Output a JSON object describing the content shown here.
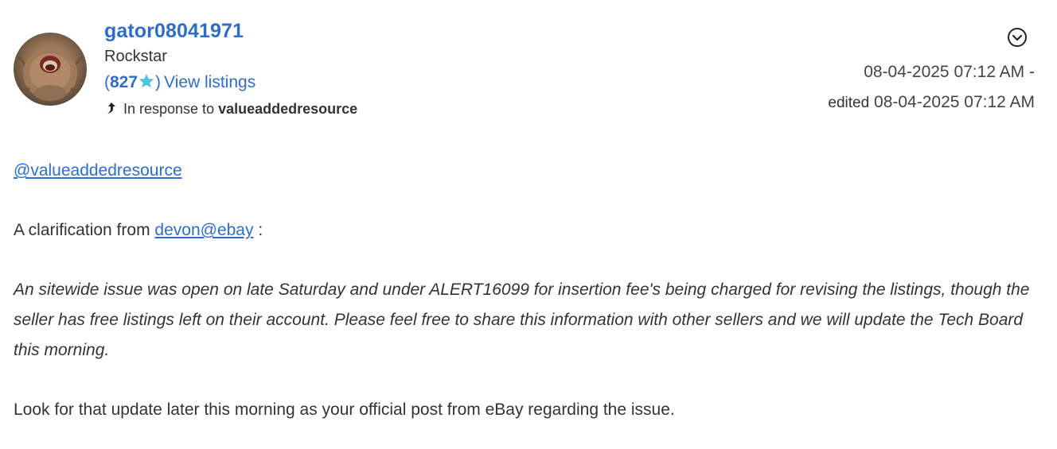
{
  "author": {
    "username": "gator08041971",
    "rank": "Rockstar",
    "feedback_open": "(",
    "feedback_score": "827",
    "feedback_close": ")",
    "view_listings": "View listings",
    "in_response_label": "In response to",
    "in_response_to": "valueaddedresource",
    "avatar_icon": "avatar-image"
  },
  "timestamps": {
    "posted": "08-04-2025 07:12 AM -",
    "edited_label": "edited",
    "edited": "08-04-2025 07:12 AM"
  },
  "post": {
    "mention": "@valueaddedresource",
    "clarify_prefix": "A clarification from",
    "clarify_link": "devon@ebay",
    "clarify_suffix": " :",
    "quote": "An sitewide issue was open on late Saturday and under ALERT16099 for insertion fee's being charged for revising the listings, though the seller has free listings left on their account. Please feel free to share this information with other sellers and we will update the Tech Board this morning.",
    "closing": "Look for that update later this morning as your official post from eBay regarding the issue."
  },
  "colors": {
    "link": "#2e6ec9",
    "text": "#333333",
    "star": "#4ec3e0"
  },
  "icons": {
    "menu": "chevron-down-circle-icon",
    "reply": "reply-arrow-icon",
    "star": "star-icon"
  }
}
